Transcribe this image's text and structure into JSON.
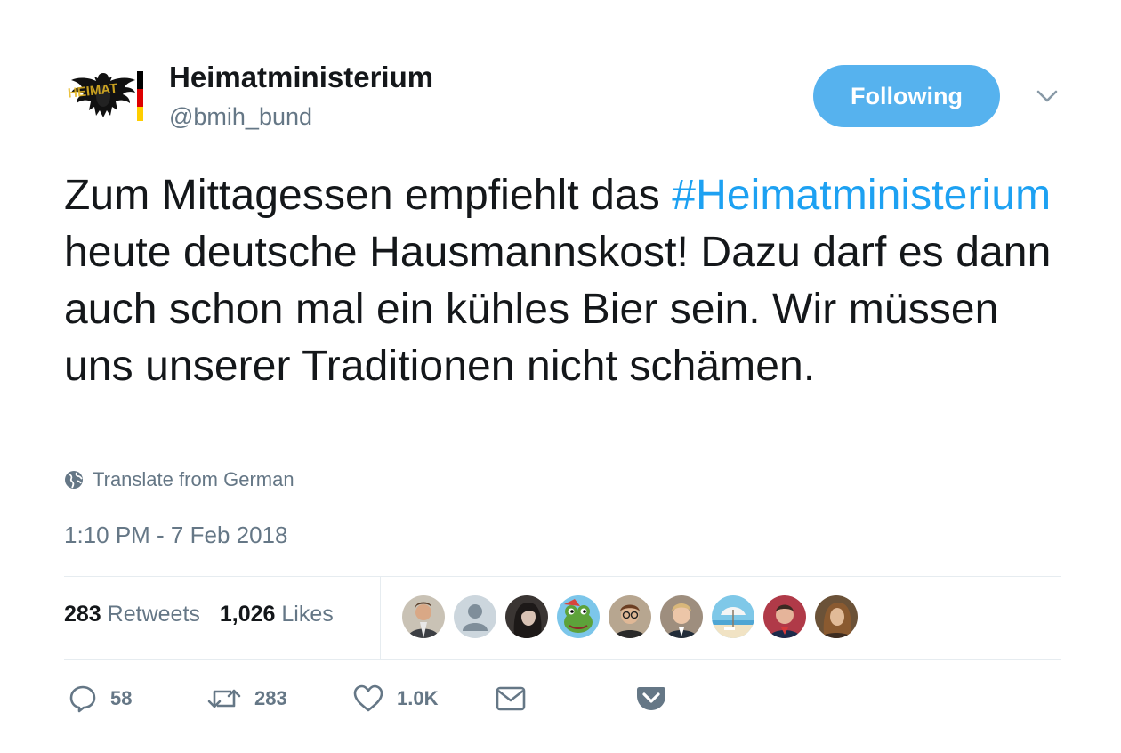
{
  "user": {
    "name": "Heimatministerium",
    "handle": "@bmih_bund",
    "avatar_overlay_text": "HEIMAT",
    "follow_label": "Following"
  },
  "tweet": {
    "text_before": "Zum Mittagessen empfiehlt das ",
    "hashtag": "#Heimatministerium",
    "text_after": " heute deutsche Hausmannskost! Dazu darf es dann auch schon mal ein kühles Bier sein. Wir müssen uns unserer Traditionen nicht schämen.",
    "translate_label": "Translate from German",
    "timestamp": "1:10 PM - 7 Feb 2018"
  },
  "stats": {
    "retweets_count": "283",
    "retweets_label": "Retweets",
    "likes_count": "1,026",
    "likes_label": "Likes"
  },
  "liked_by": [
    {
      "icon": "avatar-photo-man",
      "bg": "#c9c2b5"
    },
    {
      "icon": "avatar-default",
      "bg": "#ccd6dd"
    },
    {
      "icon": "avatar-photo-woman",
      "bg": "#3a3533"
    },
    {
      "icon": "avatar-pepe-frog",
      "bg": "#7cc6ea"
    },
    {
      "icon": "avatar-photo-man-glasses",
      "bg": "#b7a690"
    },
    {
      "icon": "avatar-photo-blond-man",
      "bg": "#9e8e7e"
    },
    {
      "icon": "avatar-beach-umbrella",
      "bg": "#7fc8e8"
    },
    {
      "icon": "avatar-photo-man-red",
      "bg": "#b03a48"
    },
    {
      "icon": "avatar-photo-woman-brown",
      "bg": "#6b5238"
    }
  ],
  "actions": {
    "reply_count": "58",
    "retweet_count": "283",
    "like_count": "1.0K"
  },
  "colors": {
    "accent": "#1da1f2",
    "follow_button": "#56b2ee",
    "secondary_text": "#657786",
    "divider": "#e6ecf0"
  }
}
